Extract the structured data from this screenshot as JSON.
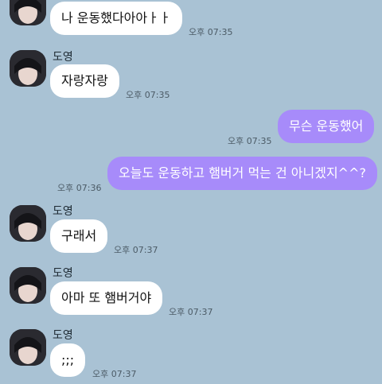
{
  "chat": {
    "messages": [
      {
        "type": "in",
        "sender": "",
        "text": "나 운동했다아아ㅏㅏ",
        "time": "오후 07:35"
      },
      {
        "type": "in",
        "sender": "도영",
        "text": "자랑자랑",
        "time": "오후 07:35"
      },
      {
        "type": "out",
        "sender": "",
        "text": "무슨 운동했어",
        "time": "오후 07:35"
      },
      {
        "type": "out",
        "sender": "",
        "text": "오늘도 운동하고 햄버거 먹는 건 아니겠지^^?",
        "time": "오후 07:36"
      },
      {
        "type": "in",
        "sender": "도영",
        "text": "구래서",
        "time": "오후 07:37"
      },
      {
        "type": "in",
        "sender": "도영",
        "text": "아마 또 햄버거야",
        "time": "오후 07:37"
      },
      {
        "type": "in",
        "sender": "도영",
        "text": ";;;",
        "time": "오후 07:37"
      }
    ]
  },
  "colors": {
    "background": "#a9c2d4",
    "incoming_bubble": "#ffffff",
    "outgoing_bubble": "#a78bfa"
  }
}
